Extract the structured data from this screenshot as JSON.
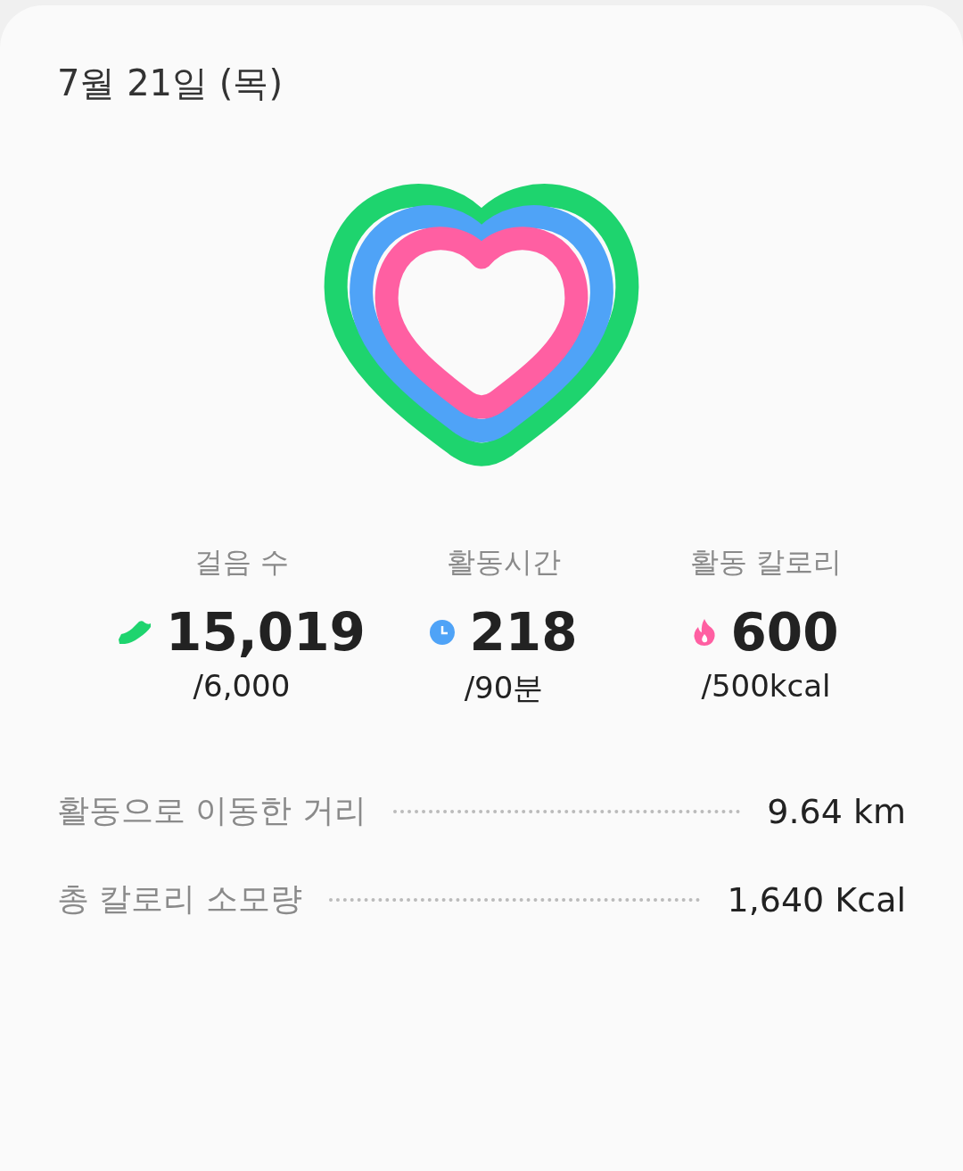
{
  "date": "7월 21일 (목)",
  "stats": [
    {
      "kind": "steps",
      "label": "걸음 수",
      "value": "15,019",
      "goal": "/6,000",
      "color": "#1ed46e"
    },
    {
      "kind": "time",
      "label": "활동시간",
      "value": "218",
      "goal": "/90분",
      "color": "#4fa3f7"
    },
    {
      "kind": "calories",
      "label": "활동 칼로리",
      "value": "600",
      "goal": "/500kcal",
      "color": "#ff5fa2"
    }
  ],
  "details": [
    {
      "label": "활동으로 이동한 거리",
      "value": "9.64 km"
    },
    {
      "label": "총 칼로리 소모량",
      "value": "1,640 Kcal"
    }
  ]
}
